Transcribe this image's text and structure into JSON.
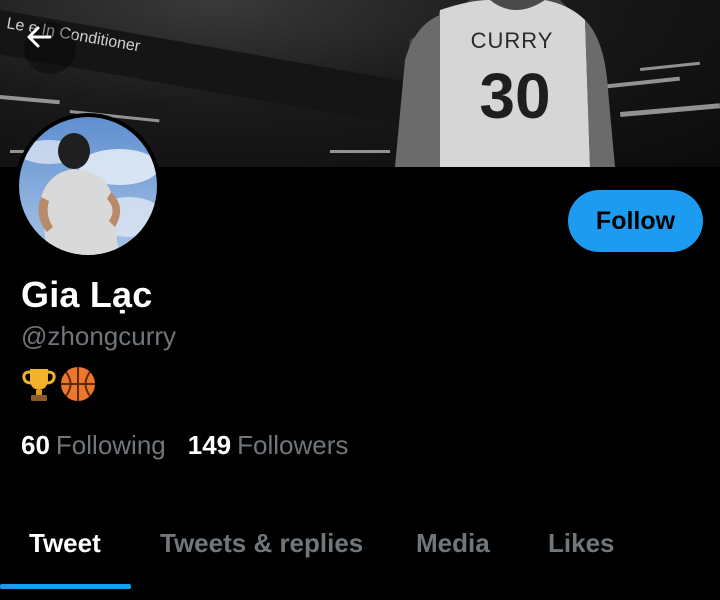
{
  "profile": {
    "name": "Gia Lạc",
    "handle": "@zhongcurry",
    "bio_emojis": [
      "🏆",
      "🏀"
    ],
    "stats": {
      "following_count": "60",
      "following_label": "Following",
      "followers_count": "149",
      "followers_label": "Followers"
    }
  },
  "banner": {
    "jersey_name": "CURRY",
    "jersey_number": "30",
    "signage_text": "Le   e In Conditioner"
  },
  "actions": {
    "follow_label": "Follow"
  },
  "tabs": [
    {
      "label": "Tweet",
      "active": true
    },
    {
      "label": "Tweets & replies",
      "active": false
    },
    {
      "label": "Media",
      "active": false
    },
    {
      "label": "Likes",
      "active": false
    }
  ],
  "colors": {
    "accent": "#1d9bf0",
    "background": "#000000",
    "secondary_text": "#71767b"
  },
  "icons": {
    "back": "arrow-left-icon"
  }
}
